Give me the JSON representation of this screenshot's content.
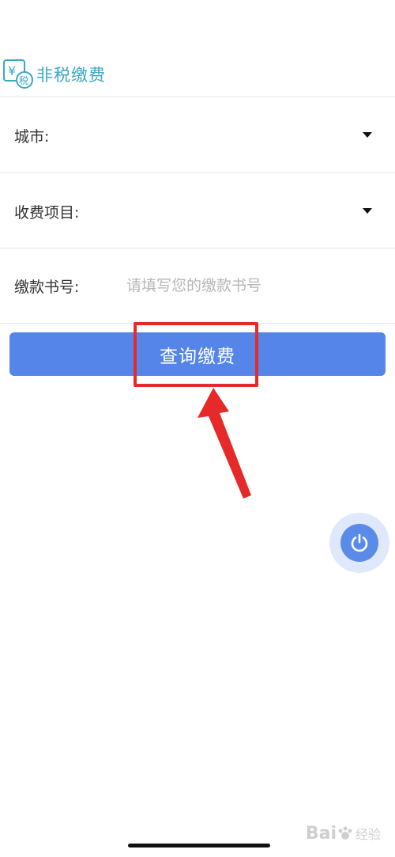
{
  "header": {
    "brand_logo_text": "¥税",
    "brand_title": "非税缴费",
    "brand_color": "#3aa7c4"
  },
  "form": {
    "city": {
      "label": "城市:",
      "icon": "caret-down-icon"
    },
    "fee_item": {
      "label": "收费项目:",
      "icon": "caret-down-icon"
    },
    "payment_number": {
      "label": "缴款书号:",
      "placeholder": "请填写您的缴款书号",
      "value": ""
    }
  },
  "actions": {
    "query_label": "查询缴费",
    "accent_color": "#5585e8"
  },
  "annotations": {
    "highlight_color": "#e62a2a"
  },
  "floating_button": {
    "icon": "power-icon"
  },
  "watermark": {
    "text": "Bai",
    "sub": "经验"
  }
}
